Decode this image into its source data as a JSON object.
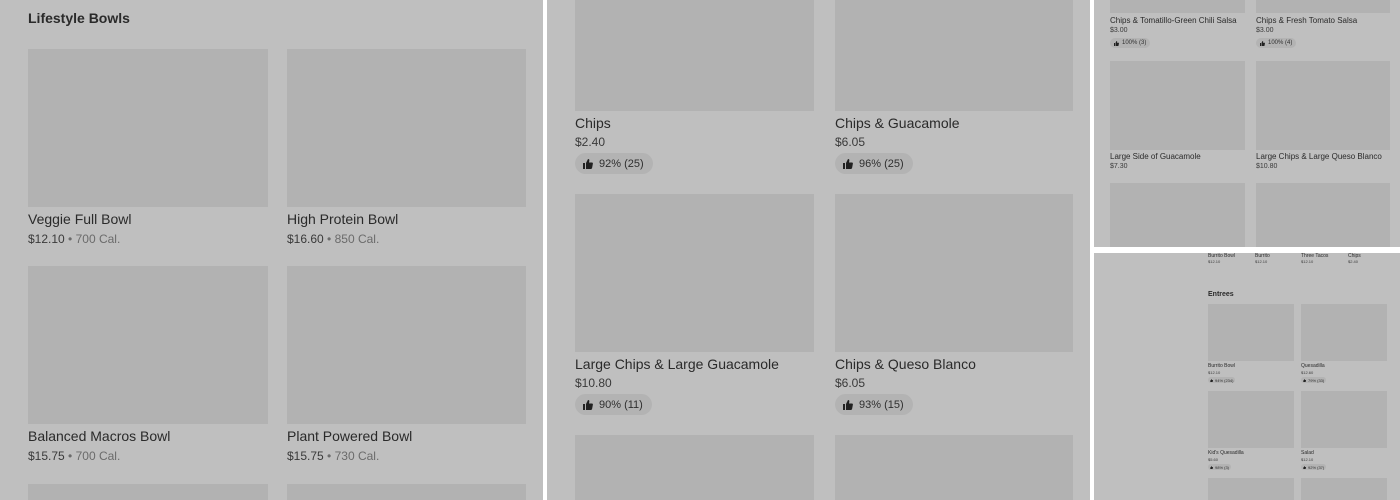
{
  "lifestyle": {
    "section_title": "Lifestyle Bowls",
    "items": [
      {
        "name": "Veggie Full Bowl",
        "price": "$12.10",
        "cal": "700 Cal."
      },
      {
        "name": "High Protein Bowl",
        "price": "$16.60",
        "cal": "850 Cal."
      },
      {
        "name": "Balanced Macros Bowl",
        "price": "$15.75",
        "cal": "700 Cal."
      },
      {
        "name": "Plant Powered Bowl",
        "price": "$15.75",
        "cal": "730 Cal."
      }
    ],
    "separator": "•"
  },
  "sides": {
    "items": [
      {
        "name": "Chips",
        "price": "$2.40",
        "rating": "92% (25)"
      },
      {
        "name": "Chips & Guacamole",
        "price": "$6.05",
        "rating": "96% (25)"
      },
      {
        "name": "Large Chips & Large Guacamole",
        "price": "$10.80",
        "rating": "90% (11)"
      },
      {
        "name": "Chips & Queso Blanco",
        "price": "$6.05",
        "rating": "93% (15)"
      }
    ]
  },
  "zoomed_sides": {
    "items": [
      {
        "name": "Chips & Tomatillo-Green Chili Salsa",
        "price": "$3.00",
        "rating": "100% (3)"
      },
      {
        "name": "Chips & Fresh Tomato Salsa",
        "price": "$3.00",
        "rating": "100% (4)"
      },
      {
        "name": "Large Side of Guacamole",
        "price": "$7.30"
      },
      {
        "name": "Large Chips & Large Queso Blanco",
        "price": "$10.80"
      }
    ]
  },
  "overview": {
    "top_row": [
      {
        "name": "Burrito Bowl",
        "price": "$12.10"
      },
      {
        "name": "Burrito",
        "price": "$12.10"
      },
      {
        "name": "Three Tacos",
        "price": "$12.10"
      },
      {
        "name": "Chips",
        "price": "$2.40"
      }
    ],
    "section_title": "Entrees",
    "items": [
      {
        "name": "Burrito Bowl",
        "price": "$12.10",
        "rating": "94% (234)"
      },
      {
        "name": "Quesadilla",
        "price": "$12.60",
        "rating": "79% (33)"
      },
      {
        "name": "Kid's Quesadilla",
        "price": "$5.60",
        "rating": "98% (3)"
      },
      {
        "name": "Salad",
        "price": "$12.10",
        "rating": "92% (37)"
      }
    ]
  },
  "colors": {
    "panel_bg": "#bfbfbf",
    "placeholder": "#b2b2b2",
    "pill_bg": "#b3b3b3",
    "divider": "#ffffff"
  },
  "icons": {
    "rating": "thumbs-up-icon"
  }
}
